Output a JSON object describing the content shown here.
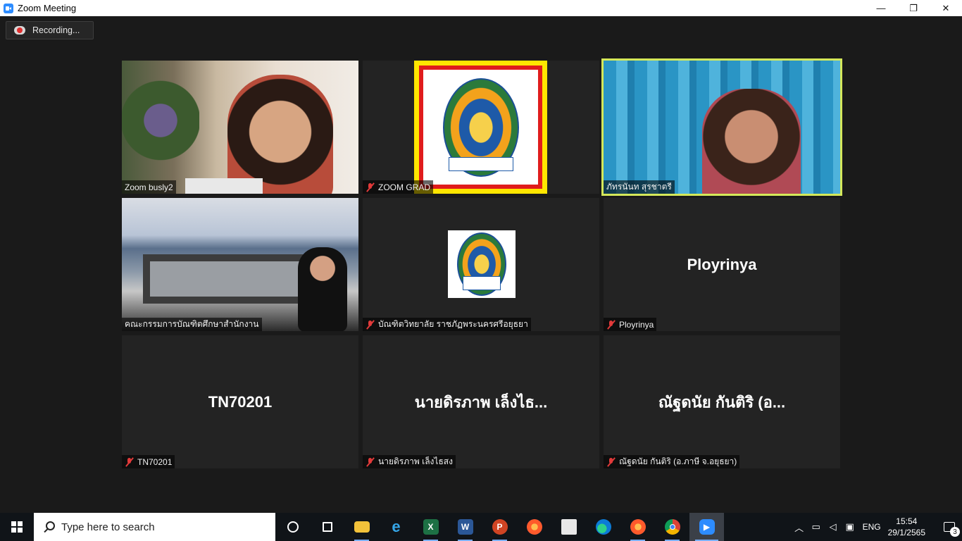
{
  "window": {
    "title": "Zoom Meeting",
    "controls": {
      "minimize": "—",
      "restore": "❐",
      "close": "✕"
    }
  },
  "recording": {
    "label": "Recording..."
  },
  "tiles": [
    {
      "name": "Zoom busly2",
      "muted": false
    },
    {
      "name": "ZOOM GRAD",
      "muted": true
    },
    {
      "name": "ภัทรนันท  สุรชาตรี",
      "muted": false,
      "active": true
    },
    {
      "name": "คณะกรรมการบัณฑิตศึกษาสำนักงาน",
      "muted": false
    },
    {
      "name": "บัณฑิตวิทยาลัย ราชภัฏพระนครศรีอยุธยา",
      "muted": true
    },
    {
      "name": "Ployrinya",
      "display": "Ployrinya",
      "muted": true
    },
    {
      "name": "TN70201",
      "display": "TN70201",
      "muted": true
    },
    {
      "name": "นายดิรภาพ  เล็งไธสง",
      "display": "นายดิรภาพ  เล็งไธ...",
      "muted": true
    },
    {
      "name": "ณัฐดนัย  กันติริ (อ.ภาษี จ.อยุธยา)",
      "display": "ณัฐดนัย  กันติริ (อ...",
      "muted": true
    }
  ],
  "taskbar": {
    "search_placeholder": "Type here to search",
    "apps": [
      "cortana-icon",
      "task-view-icon",
      "file-explorer-icon",
      "internet-explorer-icon",
      "excel-icon",
      "word-icon",
      "powerpoint-icon",
      "firefox-icon",
      "store-icon",
      "edge-icon",
      "firefox-icon",
      "chrome-icon",
      "zoom-icon"
    ],
    "tray": {
      "language": "ENG",
      "time": "15:54",
      "date": "29/1/2565",
      "notifications": "3"
    }
  }
}
